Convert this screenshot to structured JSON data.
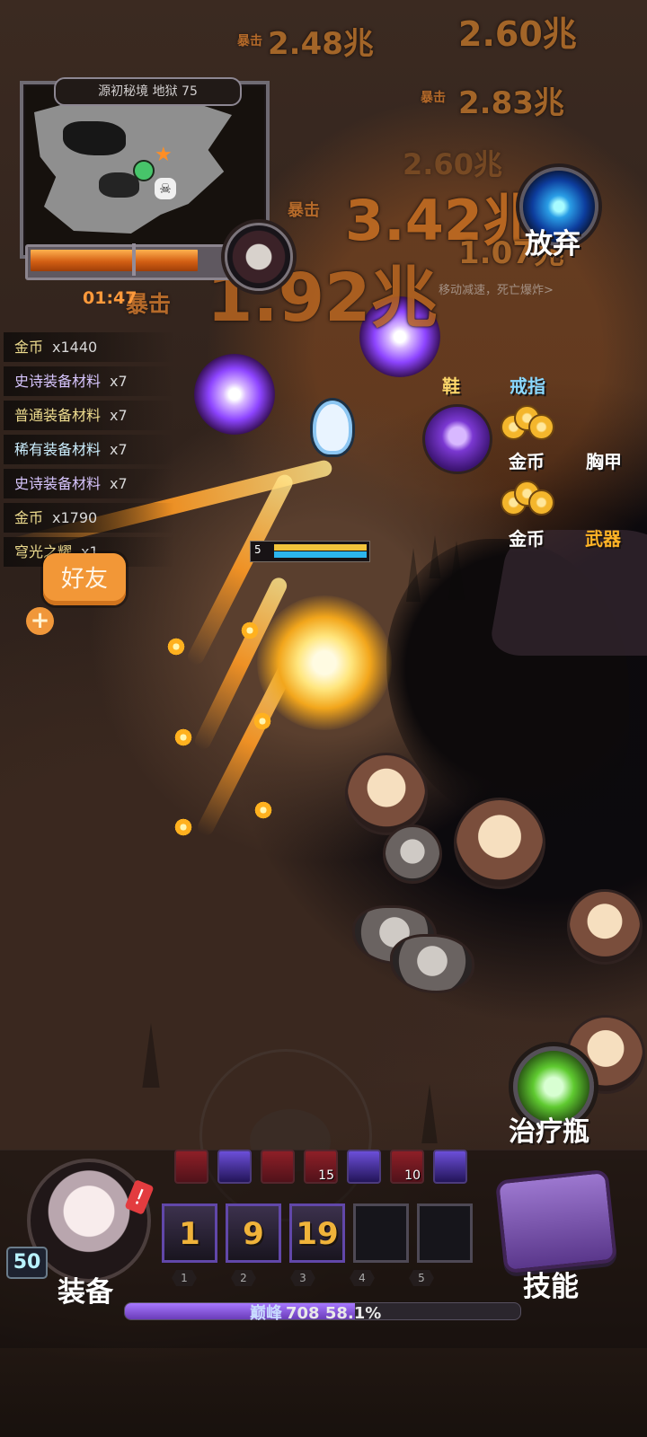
{
  "map": {
    "title": "源初秘境 地狱 75",
    "timer": "01:47",
    "boss_progress": 0.82
  },
  "damage": {
    "crit_label": "暴击",
    "numbers": [
      "2.48兆",
      "2.60兆",
      "2.83兆",
      "3.42兆",
      "2.60兆",
      "1.07兆",
      "1.92兆"
    ],
    "status_text": "移动减速，死亡爆炸>"
  },
  "loot_log": [
    {
      "name": "金币",
      "qty": "x1440"
    },
    {
      "name": "史诗装备材料",
      "qty": "x7"
    },
    {
      "name": "普通装备材料",
      "qty": "x7"
    },
    {
      "name": "稀有装备材料",
      "qty": "x7"
    },
    {
      "name": "史诗装备材料",
      "qty": "x7"
    },
    {
      "name": "金币",
      "qty": "x1790"
    },
    {
      "name": "穹光之耀",
      "qty": "x1"
    }
  ],
  "actions": {
    "friends": "好友",
    "abandon": "放弃",
    "potion": "治疗瓶",
    "skills": "技能",
    "equipment": "装备"
  },
  "drops": {
    "shoes": "鞋",
    "ring": "戒指",
    "coins1": "金币",
    "chest_armor": "胸甲",
    "coins2": "金币",
    "weapon": "武器"
  },
  "player": {
    "level": "50",
    "hero_level": "5",
    "peak_label": "巅峰",
    "peak_value": "708",
    "peak_progress": "58.1%",
    "peak_progress_value": 0.581
  },
  "abilities": [
    {
      "color": "red",
      "count": ""
    },
    {
      "color": "purple",
      "count": ""
    },
    {
      "color": "red",
      "count": ""
    },
    {
      "color": "red",
      "count": "15"
    },
    {
      "color": "purple",
      "count": ""
    },
    {
      "color": "red",
      "count": "10"
    },
    {
      "color": "purple",
      "count": ""
    }
  ],
  "equip_slots": [
    {
      "value": "1",
      "filled": true
    },
    {
      "value": "9",
      "filled": true
    },
    {
      "value": "19",
      "filled": true
    },
    {
      "value": "",
      "filled": false
    },
    {
      "value": "",
      "filled": false
    }
  ],
  "slot_numbers": [
    "1",
    "2",
    "3",
    "4",
    "5"
  ],
  "icons": {
    "alert": "!",
    "plus": "+",
    "star": "★",
    "skull": "☠",
    "boss_cap": ":"
  }
}
